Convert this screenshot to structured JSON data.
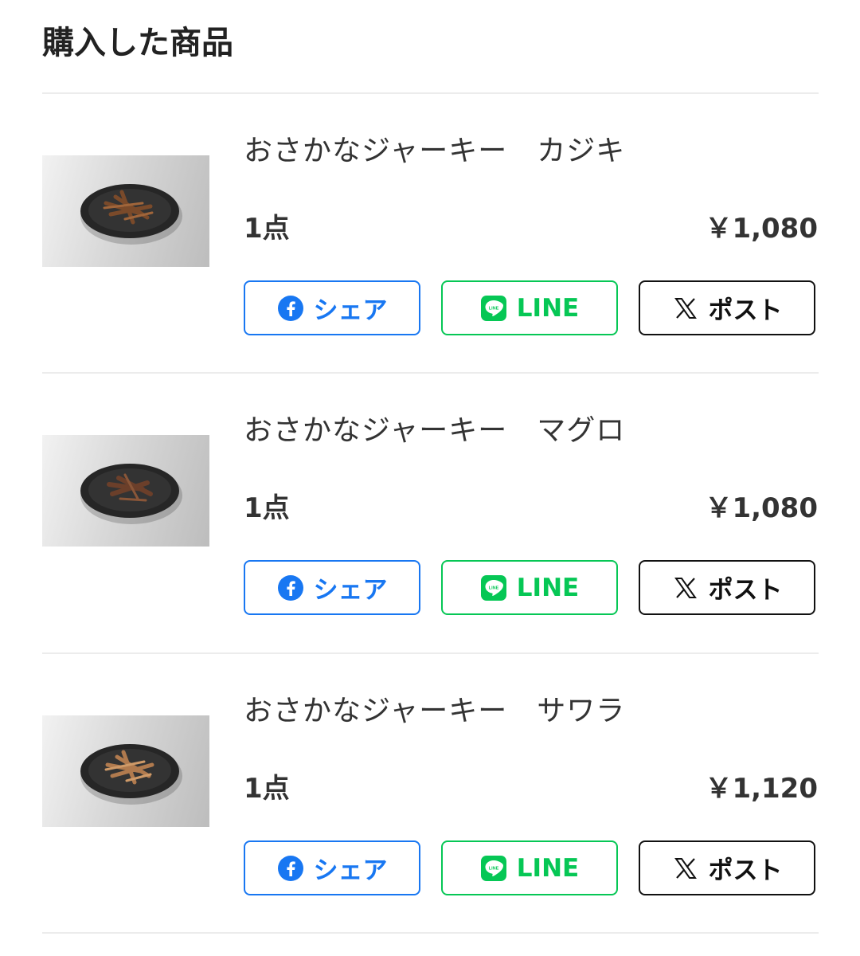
{
  "page_title": "購入した商品",
  "items": [
    {
      "name": "おさかなジャーキー　カジキ",
      "quantity": "1点",
      "price": "￥1,080",
      "share_facebook": "シェア",
      "share_line": "LINE",
      "share_x": "ポスト"
    },
    {
      "name": "おさかなジャーキー　マグロ",
      "quantity": "1点",
      "price": "￥1,080",
      "share_facebook": "シェア",
      "share_line": "LINE",
      "share_x": "ポスト"
    },
    {
      "name": "おさかなジャーキー　サワラ",
      "quantity": "1点",
      "price": "￥1,120",
      "share_facebook": "シェア",
      "share_line": "LINE",
      "share_x": "ポスト"
    }
  ],
  "icons": {
    "facebook": "facebook-icon",
    "line": "line-icon",
    "x": "x-icon"
  },
  "colors": {
    "facebook": "#1877f2",
    "line": "#06c755",
    "x": "#111111",
    "divider": "#ececec"
  }
}
